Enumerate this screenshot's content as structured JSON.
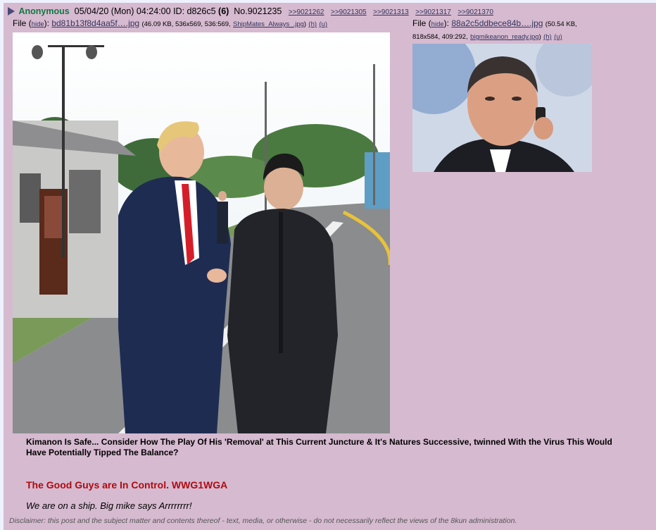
{
  "post": {
    "name": "Anonymous",
    "date": "05/04/20 (Mon) 04:24:00",
    "id_label": "ID:",
    "id_value": "d826c5",
    "id_count": "(6)",
    "number": "No.9021235",
    "backlinks": [
      ">>9021262",
      ">>9021305",
      ">>9021313",
      ">>9021317",
      ">>9021370"
    ]
  },
  "file1": {
    "prefix": "File (",
    "hide": "hide",
    "sep": "):",
    "filename": "bd81b13f8d4aa5f….jpg",
    "meta": "(46.09 KB, 536x569, 536:569,",
    "origname": "ShipMates_Always_.jpg",
    "close": ")",
    "h": "(h)",
    "u": "(u)"
  },
  "file2": {
    "prefix": "File (",
    "hide": "hide",
    "sep": "):",
    "filename": "88a2c5ddbece84b….jpg",
    "meta1": "(50.54 KB,",
    "meta2": "818x584, 409:292,",
    "origname": "bigmikeanon_ready.jpg",
    "close": ")",
    "h": "(h)",
    "u": "(u)"
  },
  "body": {
    "line1": "Kimanon Is Safe... Consider How The Play Of His 'Removal' at This Current Juncture & It's Natures Successive, twinned With the Virus This Would Have Potentially Tipped The Balance?",
    "line2": "The Good Guys are In Control. WWG1WGA",
    "line3": "We are on a ship. Big mike says Arrrrrrrr!"
  },
  "disclaimer": "Disclaimer: this post and the subject matter and contents thereof - text, media, or otherwise - do not necessarily reflect the views of the 8kun administration.",
  "colors": {
    "post_bg": "#d6bad0",
    "name": "#117743",
    "red_text": "#af0a0f",
    "link": "#34345c"
  }
}
